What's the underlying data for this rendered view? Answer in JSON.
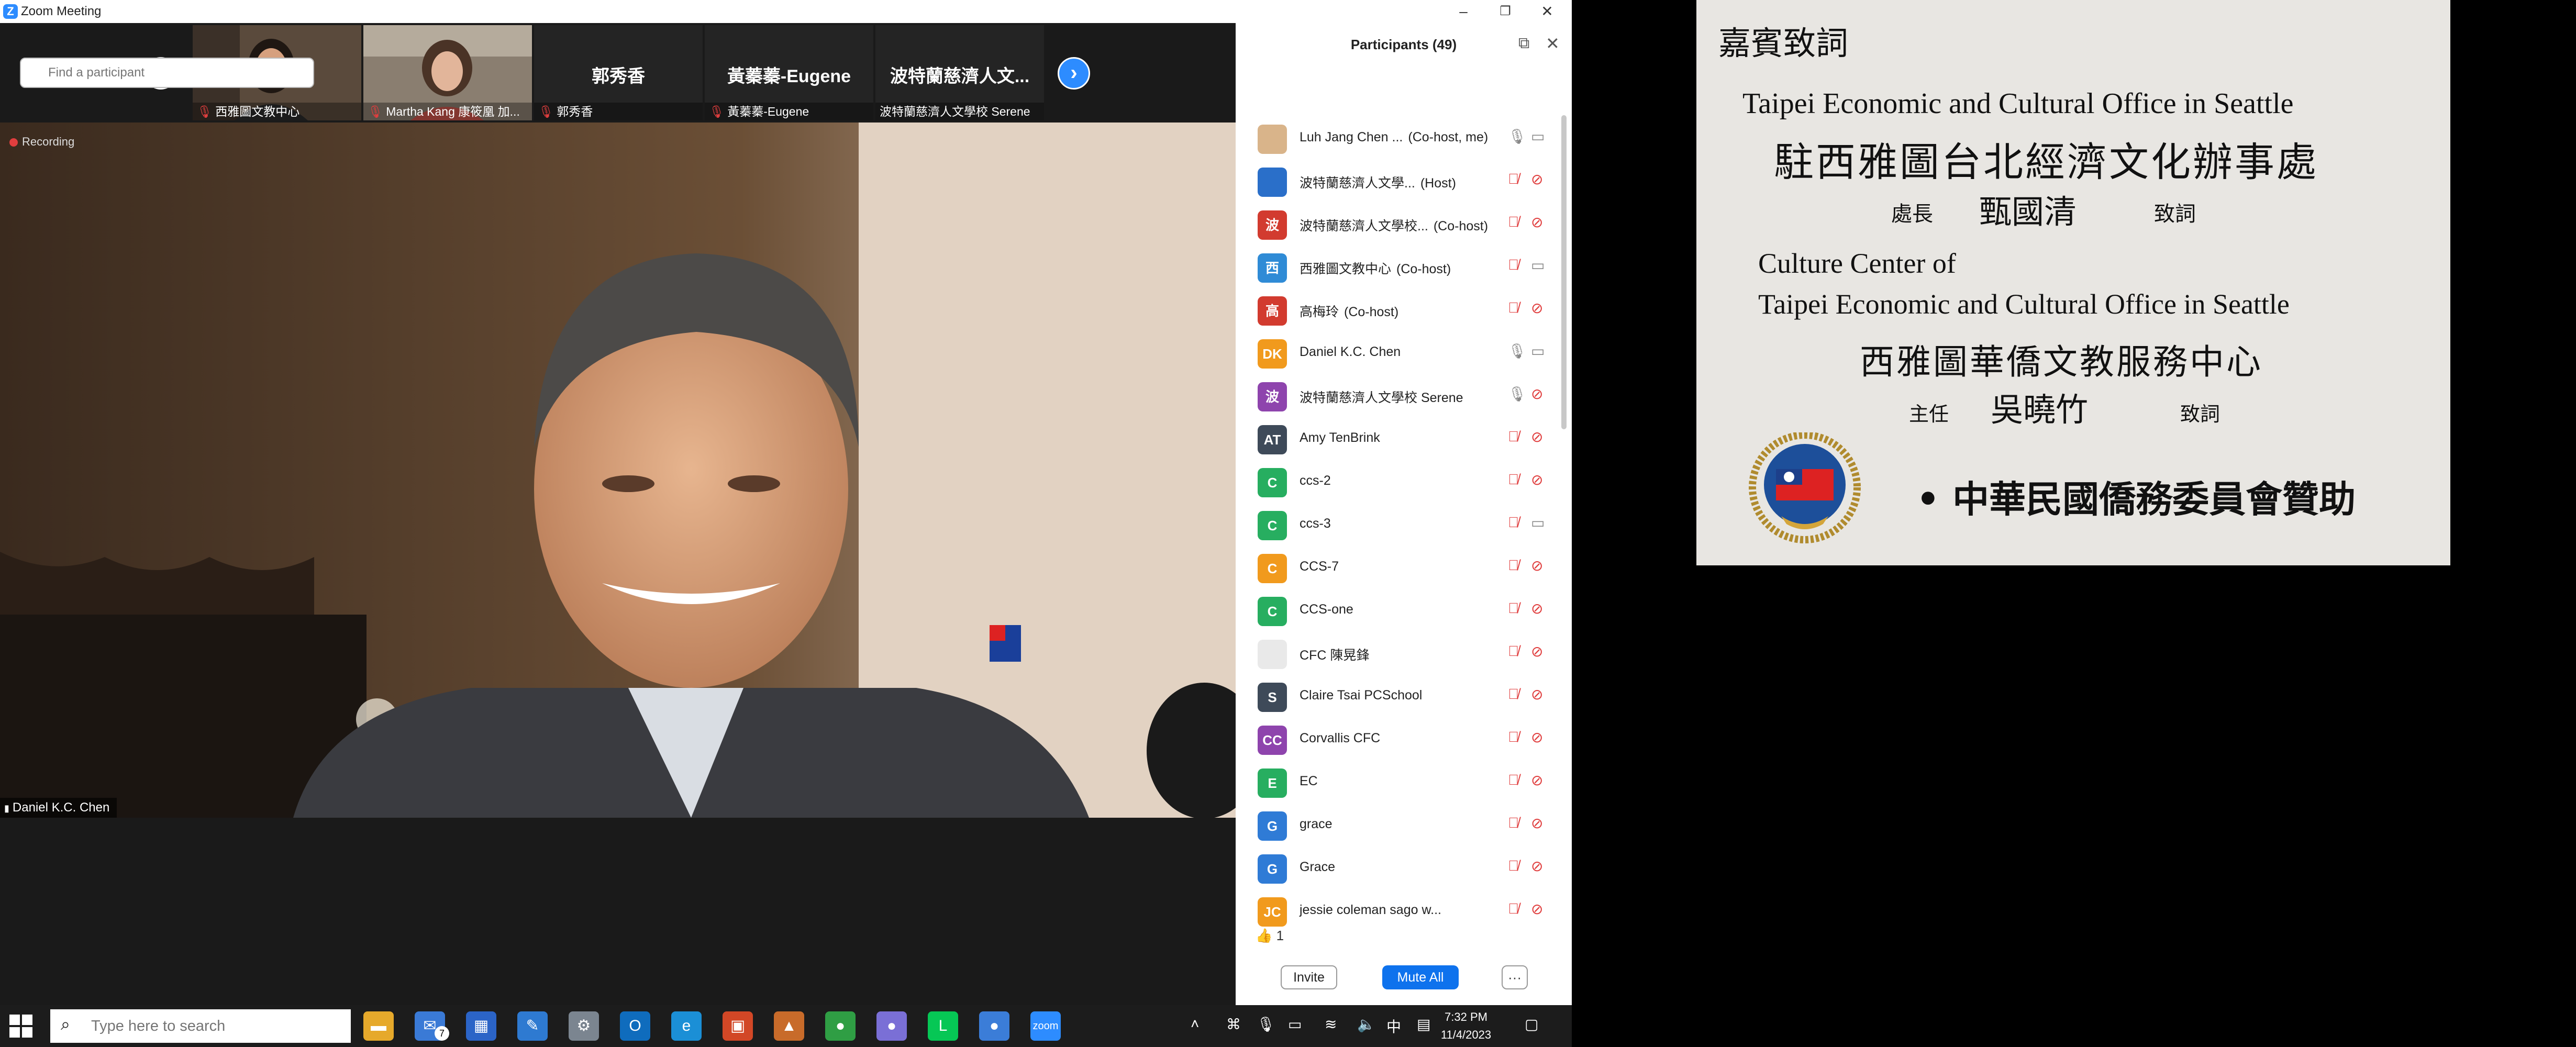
{
  "window": {
    "title": "Zoom Meeting"
  },
  "strip": {
    "thumbnails": [
      {
        "big_name": "",
        "label": "西雅圖文教中心"
      },
      {
        "big_name": "",
        "label": "Martha Kang 康筱凰 加..."
      },
      {
        "big_name": "郭秀香",
        "label": "郭秀香"
      },
      {
        "big_name": "黃蓁蓁-Eugene",
        "label": "黃蓁蓁-Eugene"
      },
      {
        "big_name": "波特蘭慈濟人文...",
        "label": "波特蘭慈濟人文學校 Serene"
      }
    ]
  },
  "main_video": {
    "recording_label": "Recording",
    "speaker_name": "Daniel K.C. Chen"
  },
  "participants": {
    "title": "Participants (49)",
    "search_placeholder": "Find a participant",
    "list": [
      {
        "name": "Luh Jang Chen ...",
        "tag": "(Co-host, me)",
        "avatar_text": "",
        "avatar_color": "#d9b48a",
        "mic": "on",
        "cam": "on"
      },
      {
        "name": "波特蘭慈濟人文學...",
        "tag": "(Host)",
        "avatar_text": "",
        "avatar_color": "#2a6fc9",
        "mic": "off",
        "cam": "off"
      },
      {
        "name": "波特蘭慈濟人文學校...",
        "tag": "(Co-host)",
        "avatar_text": "波",
        "avatar_color": "#d23b2f",
        "mic": "off",
        "cam": "off"
      },
      {
        "name": "西雅圖文教中心",
        "tag": "(Co-host)",
        "avatar_text": "西",
        "avatar_color": "#2f8bd6",
        "mic": "off",
        "cam": "on"
      },
      {
        "name": "高梅玲",
        "tag": "(Co-host)",
        "avatar_text": "高",
        "avatar_color": "#d23b2f",
        "mic": "off",
        "cam": "off"
      },
      {
        "name": "Daniel K.C. Chen",
        "tag": "",
        "avatar_text": "DK",
        "avatar_color": "#f19a1d",
        "mic": "on",
        "cam": "on"
      },
      {
        "name": "波特蘭慈濟人文學校 Serene",
        "tag": "",
        "avatar_text": "波",
        "avatar_color": "#8e44ad",
        "mic": "on",
        "cam": "off"
      },
      {
        "name": "Amy TenBrink",
        "tag": "",
        "avatar_text": "AT",
        "avatar_color": "#3e4a59",
        "mic": "off",
        "cam": "off"
      },
      {
        "name": "ccs-2",
        "tag": "",
        "avatar_text": "C",
        "avatar_color": "#27ae60",
        "mic": "off",
        "cam": "off"
      },
      {
        "name": "ccs-3",
        "tag": "",
        "avatar_text": "C",
        "avatar_color": "#27ae60",
        "mic": "off",
        "cam": "on"
      },
      {
        "name": "CCS-7",
        "tag": "",
        "avatar_text": "C",
        "avatar_color": "#f19a1d",
        "mic": "off",
        "cam": "off"
      },
      {
        "name": "CCS-one",
        "tag": "",
        "avatar_text": "C",
        "avatar_color": "#27ae60",
        "mic": "off",
        "cam": "off"
      },
      {
        "name": "CFC 陳晃鋒",
        "tag": "",
        "avatar_text": "",
        "avatar_color": "#e9e9e9",
        "mic": "off",
        "cam": "off"
      },
      {
        "name": "Claire Tsai PCSchool",
        "tag": "",
        "avatar_text": "S",
        "avatar_color": "#3e4a59",
        "mic": "off",
        "cam": "off"
      },
      {
        "name": "Corvallis CFC",
        "tag": "",
        "avatar_text": "CC",
        "avatar_color": "#8e44ad",
        "mic": "off",
        "cam": "off"
      },
      {
        "name": "EC",
        "tag": "",
        "avatar_text": "E",
        "avatar_color": "#27ae60",
        "mic": "off",
        "cam": "off"
      },
      {
        "name": "grace",
        "tag": "",
        "avatar_text": "G",
        "avatar_color": "#2f7bd6",
        "mic": "off",
        "cam": "off"
      },
      {
        "name": "Grace",
        "tag": "",
        "avatar_text": "G",
        "avatar_color": "#2f7bd6",
        "mic": "off",
        "cam": "off"
      },
      {
        "name": "jessie coleman sago w...",
        "tag": "",
        "avatar_text": "JC",
        "avatar_color": "#f19a1d",
        "mic": "off",
        "cam": "off"
      }
    ],
    "reaction": {
      "icon": "👍",
      "count": "1"
    },
    "invite_label": "Invite",
    "mute_all_label": "Mute All",
    "more_label": "···"
  },
  "slide": {
    "heading": "嘉賓致詞",
    "line1_en": "Taipei Economic and Cultural Office in Seattle",
    "line1_zh": "駐西雅圖台北經濟文化辦事處",
    "speaker1_title": "處長",
    "speaker1_name": "甄國清",
    "speaker1_action": "致詞",
    "line2_en_a": "Culture Center of",
    "line2_en_b": "Taipei Economic and Cultural Office in Seattle",
    "line2_zh": "西雅圖華僑文教服務中心",
    "speaker2_title": "主任",
    "speaker2_name": "吳曉竹",
    "speaker2_action": "致詞",
    "sponsor": "• 中華民國僑務委員會贊助"
  },
  "taskbar": {
    "search_placeholder": "Type here to search",
    "time": "7:32 PM",
    "date": "11/4/2023",
    "ime": "中",
    "mail_badge": "7",
    "app_icons": [
      "file-explorer-icon",
      "mail-icon",
      "store-icon",
      "paint-icon",
      "settings-icon",
      "outlook-icon",
      "edge-icon",
      "office-icon",
      "photos-icon",
      "chrome-icon",
      "chrome-canary-icon",
      "line-icon",
      "chrome-profile-icon",
      "zoom-icon"
    ]
  }
}
